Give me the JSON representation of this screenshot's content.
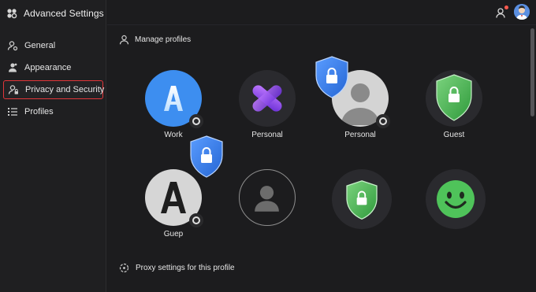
{
  "app": {
    "title": "Advanced Settings"
  },
  "sidebar": {
    "items": [
      {
        "label": "General",
        "icon": "user-gear-icon"
      },
      {
        "label": "Appearance",
        "icon": "appearance-icon"
      },
      {
        "label": "Privacy and Security",
        "icon": "privacy-icon",
        "selected": true
      },
      {
        "label": "Profiles",
        "icon": "list-icon"
      }
    ]
  },
  "topbar": {
    "notification_icon": "notification-person-icon",
    "avatar_icon": "user-avatar-icon"
  },
  "main": {
    "section_title": "Manage profiles",
    "proxy_label": "Proxy settings for this profile",
    "profiles": [
      {
        "label": "Work",
        "letter": "A",
        "style": "blue-app"
      },
      {
        "label": "Personal",
        "style": "purple-x"
      },
      {
        "label": "Personal",
        "style": "gray-person"
      },
      {
        "label": "Guest",
        "style": "green-shield"
      },
      {
        "label": "Guep",
        "letter": "A",
        "style": "white-letter"
      },
      {
        "label": "",
        "style": "outline-person"
      },
      {
        "label": "",
        "style": "green-shield"
      },
      {
        "label": "",
        "style": "smiley"
      }
    ]
  },
  "colors": {
    "accent_red": "#e2363a",
    "shield_blue": "#3b7ee8",
    "shield_green": "#4cb556",
    "work_blue": "#3d8ef0"
  }
}
